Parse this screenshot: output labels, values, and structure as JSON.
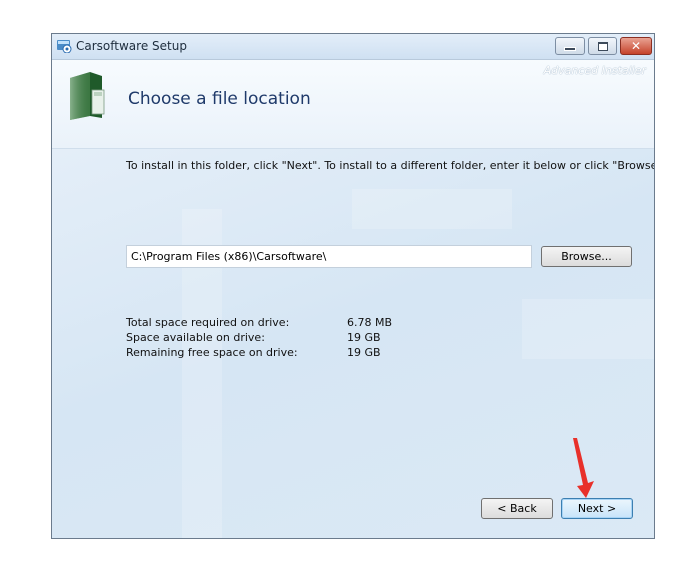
{
  "window": {
    "title": "Carsoftware Setup",
    "controls": {
      "minimize": "minimize",
      "maximize": "maximize",
      "close": "✕"
    }
  },
  "header": {
    "title": "Choose a file location",
    "brand": "Advanced Installer"
  },
  "main": {
    "instructions": "To install in this folder, click \"Next\". To install to a different folder, enter it below or click \"Browse\".",
    "path_value": "C:\\Program Files (x86)\\Carsoftware\\",
    "browse_label": "Browse...",
    "space_info": [
      {
        "label": "Total space required on drive:",
        "value": "6.78 MB"
      },
      {
        "label": "Space available on drive:",
        "value": "19 GB"
      },
      {
        "label": "Remaining free space on drive:",
        "value": "19 GB"
      }
    ]
  },
  "footer": {
    "back_label": "< Back",
    "next_label": "Next >"
  },
  "annotation": {
    "color": "#e8302a",
    "icon": "red-arrow-pointing-down"
  }
}
